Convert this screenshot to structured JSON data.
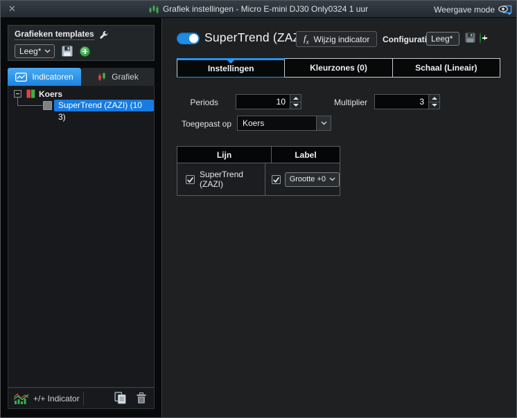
{
  "titlebar": {
    "close": "✕",
    "title": "Grafiek instellingen - Micro E-mini DJ30 Only0324 1 uur",
    "view_mode": "Weergave mode"
  },
  "sidebar": {
    "templates_label": "Grafieken templates",
    "templates_dropdown": "Leeg*",
    "tabs": [
      {
        "label": "Indicatoren",
        "active": true
      },
      {
        "label": "Grafiek",
        "active": false
      }
    ],
    "tree": {
      "root_label": "Koers",
      "child_label": "SuperTrend (ZAZI) (10 3)",
      "child_selected": true
    },
    "footer": {
      "add_label": "+/+ Indicator"
    }
  },
  "main": {
    "toggle_on": true,
    "title": "SuperTrend (ZAZI)",
    "edit_button": {
      "f": "f",
      "x": "x",
      "label": "Wijzig indicator"
    },
    "config_label": "Configuratie:",
    "config_dropdown": "Leeg*",
    "tabs": [
      {
        "label": "Instellingen",
        "active": true
      },
      {
        "label": "Kleurzones (0)",
        "active": false
      },
      {
        "label": "Schaal (Lineair)",
        "active": false
      }
    ],
    "form": {
      "periods_label": "Periods",
      "periods_value": "10",
      "multiplier_label": "Multiplier",
      "multiplier_value": "3",
      "applied_label": "Toegepast op",
      "applied_value": "Koers"
    },
    "table": {
      "headers": [
        "Lijn",
        "Label"
      ],
      "row": {
        "line_label": "SuperTrend (ZAZI)",
        "line_checked": true,
        "label_checked": true,
        "label_value": "Grootte +0"
      }
    }
  },
  "colors": {
    "accent_blue": "#2196f3",
    "selection_blue": "#177be0",
    "plus_green": "#2f9e3f",
    "candle_red": "#e0453e",
    "candle_green": "#3fae49",
    "titlebar_bg": "#2b323a",
    "panel_bg": "#1e2022"
  }
}
